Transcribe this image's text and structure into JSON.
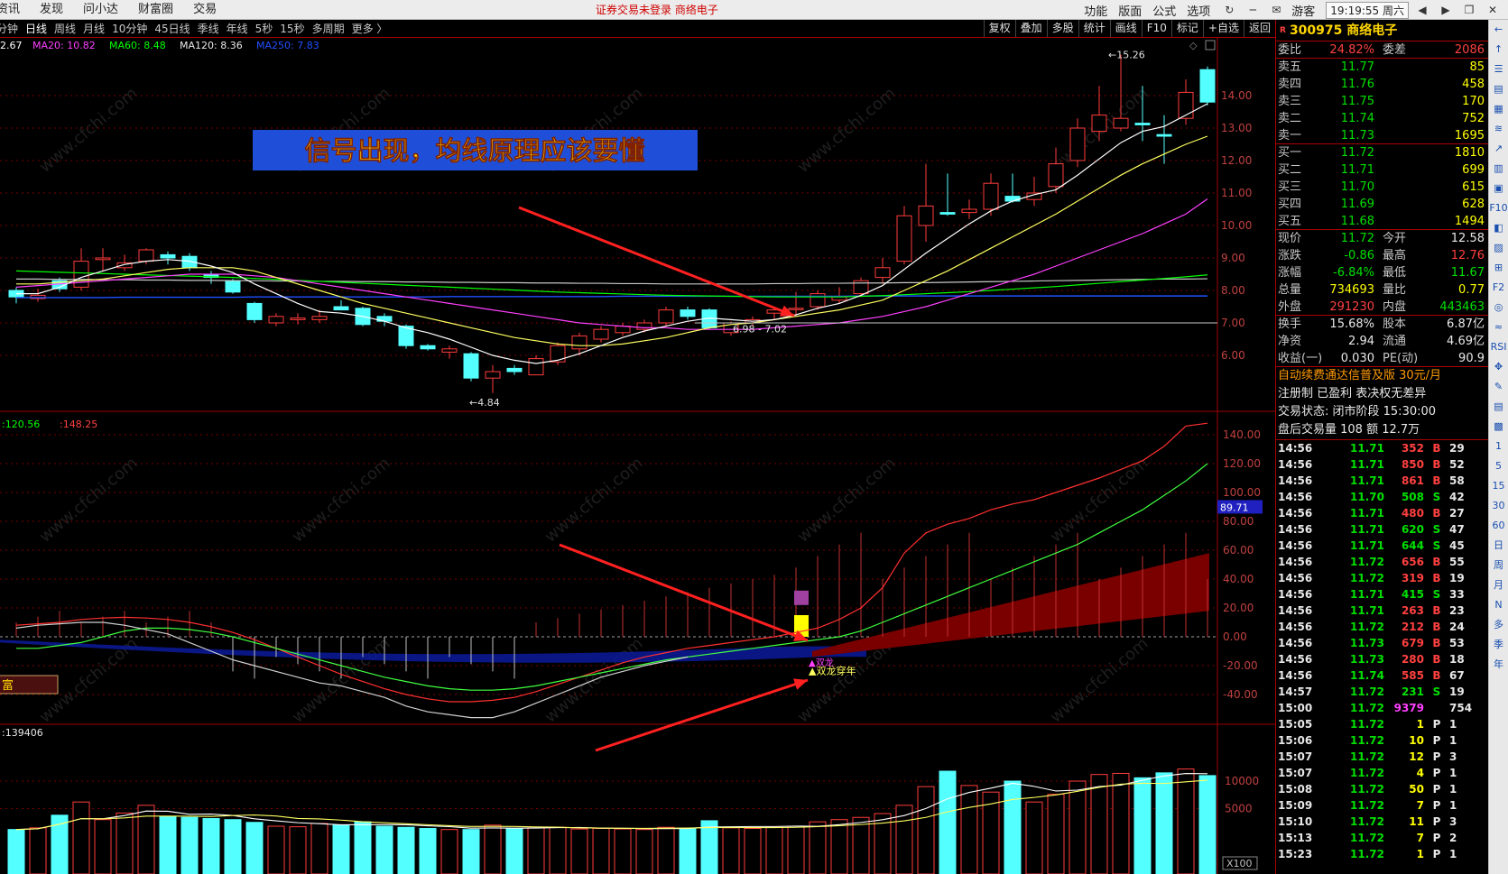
{
  "top_menu": [
    "资讯",
    "发现",
    "问小达",
    "财富圈",
    "交易"
  ],
  "top_status": "证券交易未登录   商络电子",
  "top_right": {
    "items": [
      "功能",
      "版面",
      "公式",
      "选项"
    ],
    "icons": [
      "refresh-icon",
      "minimize-icon",
      "mail-icon"
    ],
    "guest": "游客",
    "clock": "19:19:55 周六",
    "window_icons": [
      "back-icon",
      "forward-icon",
      "restore-icon",
      "close-icon"
    ]
  },
  "period_tabs": [
    "分钟",
    "日线",
    "周线",
    "月线",
    "10分钟",
    "45日线",
    "季线",
    "年线",
    "5秒",
    "15秒",
    "多周期",
    "更多 〉"
  ],
  "active_period": "日线",
  "chart_tools": [
    "复权",
    "叠加",
    "多股",
    "统计",
    "画线",
    "F10",
    "标记",
    "+自选",
    "返回"
  ],
  "ma_legend": [
    {
      "text": "2.67",
      "color": "#ffffff"
    },
    {
      "text": "MA20: 10.82",
      "color": "#ff40ff"
    },
    {
      "text": "MA60: 8.48",
      "color": "#00ff00"
    },
    {
      "text": "MA120: 8.36",
      "color": "#e8e8e8"
    },
    {
      "text": "MA250: 7.83",
      "color": "#2050ff"
    }
  ],
  "annotation_title": "信号出现，均线原理应该要懂",
  "price_axis": [
    "14.00",
    "13.00",
    "12.00",
    "11.00",
    "10.00",
    "9.00",
    "8.00",
    "7.00",
    "6.00"
  ],
  "price_labels": {
    "high": "15.26",
    "low": "4.84",
    "range": "6.98 - 7.02"
  },
  "indicator_header": {
    "v1": "120.56",
    "v2": "148.25"
  },
  "indicator_axis": [
    "140.00",
    "120.00",
    "100.00",
    "80.00",
    "60.00",
    "40.00",
    "20.00",
    "0.00",
    "-20.00",
    "-40.00"
  ],
  "indicator_marker": "89.71",
  "indicator_labels": {
    "signal_top": "双龙",
    "signal": "双龙穿年"
  },
  "left_tag": "富",
  "volume_header": "139406",
  "volume_axis": [
    "10000",
    "5000"
  ],
  "volume_unit": "X100",
  "stock": {
    "code": "300975",
    "name": "商络电子"
  },
  "order_book": {
    "wei_bi": {
      "label": "委比",
      "value": "24.82%",
      "label2": "委差",
      "value2": "2086"
    },
    "asks": [
      {
        "label": "卖五",
        "price": "11.77",
        "vol": "85"
      },
      {
        "label": "卖四",
        "price": "11.76",
        "vol": "458"
      },
      {
        "label": "卖三",
        "price": "11.75",
        "vol": "170"
      },
      {
        "label": "卖二",
        "price": "11.74",
        "vol": "752"
      },
      {
        "label": "卖一",
        "price": "11.73",
        "vol": "1695"
      }
    ],
    "bids": [
      {
        "label": "买一",
        "price": "11.72",
        "vol": "1810"
      },
      {
        "label": "买二",
        "price": "11.71",
        "vol": "699"
      },
      {
        "label": "买三",
        "price": "11.70",
        "vol": "615"
      },
      {
        "label": "买四",
        "price": "11.69",
        "vol": "628"
      },
      {
        "label": "买五",
        "price": "11.68",
        "vol": "1494"
      }
    ]
  },
  "stats": [
    {
      "l1": "现价",
      "v1": "11.72",
      "c1": "green",
      "l2": "今开",
      "v2": "12.58",
      "c2": "white"
    },
    {
      "l1": "涨跌",
      "v1": "-0.86",
      "c1": "green",
      "l2": "最高",
      "v2": "12.76",
      "c2": "red"
    },
    {
      "l1": "涨幅",
      "v1": "-6.84%",
      "c1": "green",
      "l2": "最低",
      "v2": "11.67",
      "c2": "green"
    },
    {
      "l1": "总量",
      "v1": "734693",
      "c1": "yellow",
      "l2": "量比",
      "v2": "0.77",
      "c2": "yellow"
    },
    {
      "l1": "外盘",
      "v1": "291230",
      "c1": "red",
      "l2": "内盘",
      "v2": "443463",
      "c2": "green"
    },
    {
      "l1": "换手",
      "v1": "15.68%",
      "c1": "white",
      "l2": "股本",
      "v2": "6.87亿",
      "c2": "white"
    },
    {
      "l1": "净资",
      "v1": "2.94",
      "c1": "white",
      "l2": "流通",
      "v2": "4.69亿",
      "c2": "white"
    },
    {
      "l1": "收益(一)",
      "v1": "0.030",
      "c1": "white",
      "l2": "PE(动)",
      "v2": "90.9",
      "c2": "white"
    }
  ],
  "info_lines": [
    {
      "text": "自动续费通达信普及版  30元/月",
      "cls": "orange"
    },
    {
      "text": "注册制 已盈利 表决权无差异",
      "cls": ""
    },
    {
      "text": "交易状态: 闭市阶段 15:30:00",
      "cls": ""
    },
    {
      "text": "盘后交易量 108 额 12.7万",
      "cls": ""
    }
  ],
  "ticks": [
    {
      "t": "14:56",
      "p": "11.71",
      "v": "352",
      "bs": "B",
      "n": "29"
    },
    {
      "t": "14:56",
      "p": "11.71",
      "v": "850",
      "bs": "B",
      "n": "52"
    },
    {
      "t": "14:56",
      "p": "11.71",
      "v": "861",
      "bs": "B",
      "n": "58"
    },
    {
      "t": "14:56",
      "p": "11.70",
      "v": "508",
      "bs": "S",
      "n": "42"
    },
    {
      "t": "14:56",
      "p": "11.71",
      "v": "480",
      "bs": "B",
      "n": "27"
    },
    {
      "t": "14:56",
      "p": "11.71",
      "v": "620",
      "bs": "S",
      "n": "47"
    },
    {
      "t": "14:56",
      "p": "11.71",
      "v": "644",
      "bs": "S",
      "n": "45"
    },
    {
      "t": "14:56",
      "p": "11.72",
      "v": "656",
      "bs": "B",
      "n": "55"
    },
    {
      "t": "14:56",
      "p": "11.72",
      "v": "319",
      "bs": "B",
      "n": "19"
    },
    {
      "t": "14:56",
      "p": "11.71",
      "v": "415",
      "bs": "S",
      "n": "33"
    },
    {
      "t": "14:56",
      "p": "11.71",
      "v": "263",
      "bs": "B",
      "n": "23"
    },
    {
      "t": "14:56",
      "p": "11.72",
      "v": "212",
      "bs": "B",
      "n": "24"
    },
    {
      "t": "14:56",
      "p": "11.73",
      "v": "679",
      "bs": "B",
      "n": "53"
    },
    {
      "t": "14:56",
      "p": "11.73",
      "v": "280",
      "bs": "B",
      "n": "18"
    },
    {
      "t": "14:56",
      "p": "11.74",
      "v": "585",
      "bs": "B",
      "n": "67"
    },
    {
      "t": "14:57",
      "p": "11.72",
      "v": "231",
      "bs": "S",
      "n": "19"
    },
    {
      "t": "15:00",
      "p": "11.72",
      "v": "9379",
      "bs": "",
      "n": "754"
    },
    {
      "t": "15:05",
      "p": "11.72",
      "v": "1",
      "bs": "P",
      "n": "1"
    },
    {
      "t": "15:06",
      "p": "11.72",
      "v": "10",
      "bs": "P",
      "n": "1"
    },
    {
      "t": "15:07",
      "p": "11.72",
      "v": "12",
      "bs": "P",
      "n": "3"
    },
    {
      "t": "15:07",
      "p": "11.72",
      "v": "4",
      "bs": "P",
      "n": "1"
    },
    {
      "t": "15:08",
      "p": "11.72",
      "v": "50",
      "bs": "P",
      "n": "1"
    },
    {
      "t": "15:09",
      "p": "11.72",
      "v": "7",
      "bs": "P",
      "n": "1"
    },
    {
      "t": "15:10",
      "p": "11.72",
      "v": "11",
      "bs": "P",
      "n": "3"
    },
    {
      "t": "15:13",
      "p": "11.72",
      "v": "7",
      "bs": "P",
      "n": "2"
    },
    {
      "t": "15:23",
      "p": "11.72",
      "v": "1",
      "bs": "P",
      "n": "1"
    }
  ],
  "sidebar_items": [
    "←",
    "↑",
    "☰",
    "▤",
    "▦",
    "≋",
    "↗",
    "▥",
    "▣",
    "F10",
    "◧",
    "▨",
    "⊞",
    "F2",
    "◎",
    "≈",
    "RSI",
    "✥",
    "✎",
    "▤",
    "▩",
    "1",
    "5",
    "15",
    "30",
    "60",
    "日",
    "周",
    "月",
    "N",
    "多",
    "季",
    "年"
  ],
  "watermark": "www.cfchi.com"
}
